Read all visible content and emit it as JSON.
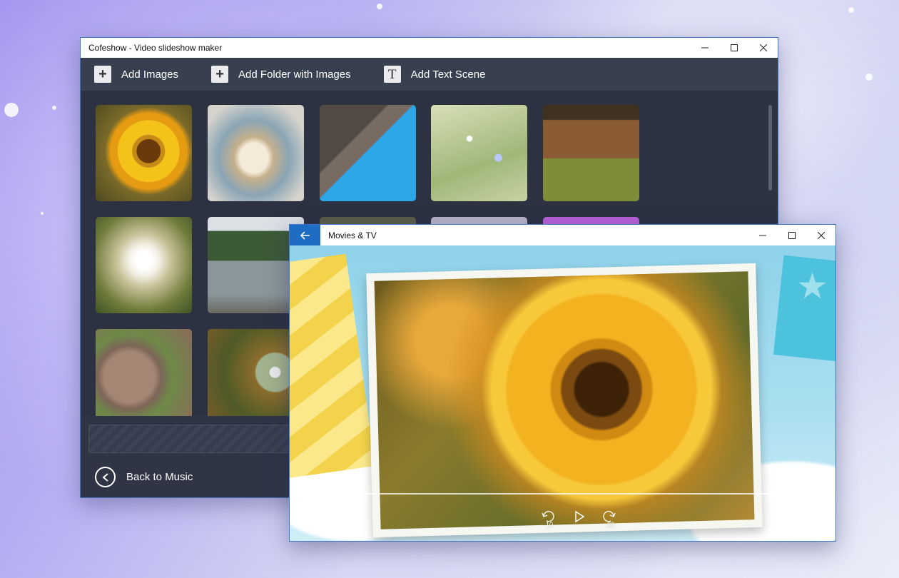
{
  "cofeshow": {
    "title": "Cofeshow - Video slideshow maker",
    "toolbar": {
      "add_images": "Add Images",
      "add_folder": "Add Folder with Images",
      "add_text_scene": "Add Text Scene"
    },
    "back_to_music": "Back to Music"
  },
  "movies": {
    "title": "Movies & TV",
    "controls": {
      "skip_back_seconds": "10",
      "skip_forward_seconds": "30",
      "progress": 0
    }
  }
}
